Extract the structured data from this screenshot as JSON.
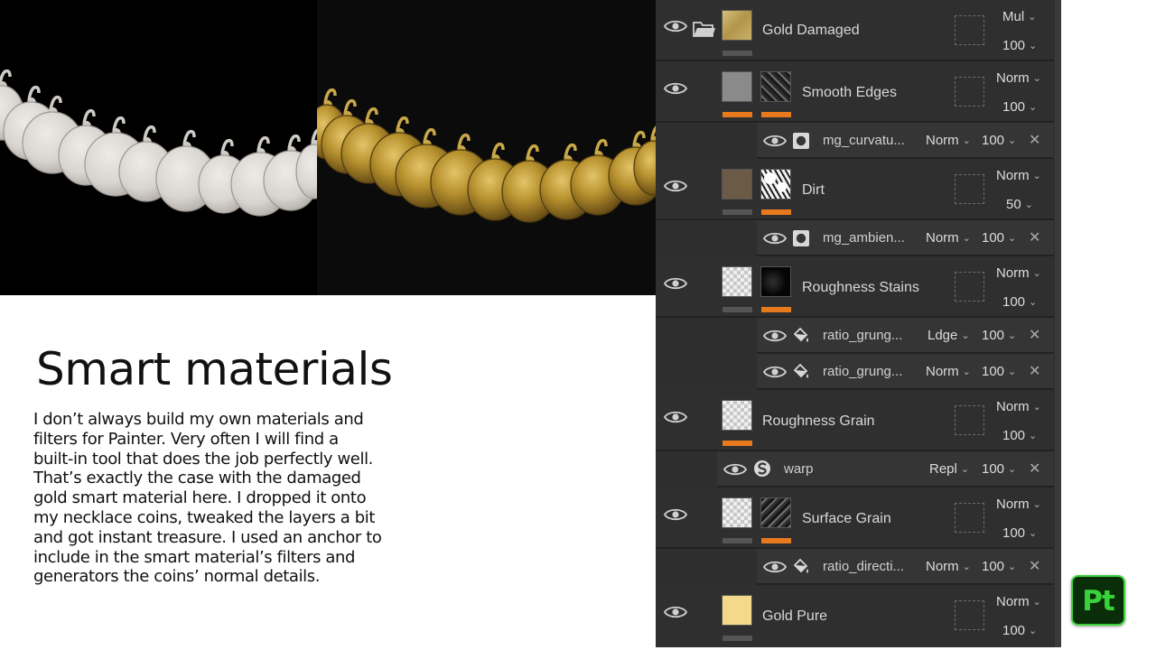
{
  "slide": {
    "title": "Smart materials",
    "body_lines": [
      "I don’t always build my own materials and",
      "filters for Painter. Very often I will find a",
      "built-in tool that does the job perfectly well.",
      "That’s exactly the case with the damaged",
      "gold smart material here. I dropped it onto",
      "my necklace coins, tweaked the layers a bit",
      "and got instant treasure. I used an anchor to",
      "include in the smart material’s filters and",
      "generators the coins’ normal details."
    ]
  },
  "colors": {
    "panel_bg": "#2e2e2e",
    "accent_orange": "#e87a1e",
    "painter_green": "#3ad23a",
    "gold": "#b8922e",
    "clay": "#d8d4cf"
  },
  "layers": {
    "gold_damaged": {
      "name": "Gold Damaged",
      "blend": "Mul",
      "opacity": "100"
    },
    "smooth_edges": {
      "name": "Smooth Edges",
      "blend": "Norm",
      "opacity": "100",
      "effects": [
        {
          "name": "mg_curvatu...",
          "blend": "Norm",
          "opacity": "100"
        }
      ]
    },
    "dirt": {
      "name": "Dirt",
      "blend": "Norm",
      "opacity": "50",
      "effects": [
        {
          "name": "mg_ambien...",
          "blend": "Norm",
          "opacity": "100"
        }
      ]
    },
    "roughness_stains": {
      "name": "Roughness Stains",
      "blend": "Norm",
      "opacity": "100",
      "effects": [
        {
          "name": "ratio_grung...",
          "blend": "Ldge",
          "opacity": "100"
        },
        {
          "name": "ratio_grung...",
          "blend": "Norm",
          "opacity": "100"
        }
      ]
    },
    "roughness_grain": {
      "name": "Roughness Grain",
      "blend": "Norm",
      "opacity": "100",
      "effects": [
        {
          "name": "warp",
          "blend": "Repl",
          "opacity": "100"
        }
      ]
    },
    "surface_grain": {
      "name": "Surface Grain",
      "blend": "Norm",
      "opacity": "100",
      "effects": [
        {
          "name": "ratio_directi...",
          "blend": "Norm",
          "opacity": "100"
        }
      ]
    },
    "gold_pure": {
      "name": "Gold Pure",
      "blend": "Norm",
      "opacity": "100"
    }
  },
  "icons": {
    "visibility": "eye-icon",
    "folder": "folder-icon",
    "remove": "close-icon",
    "generator": "generator-icon",
    "fill": "fill-icon",
    "warp": "warp-icon",
    "chevron": "chevron-down-icon"
  },
  "badge": {
    "text": "Pt"
  }
}
